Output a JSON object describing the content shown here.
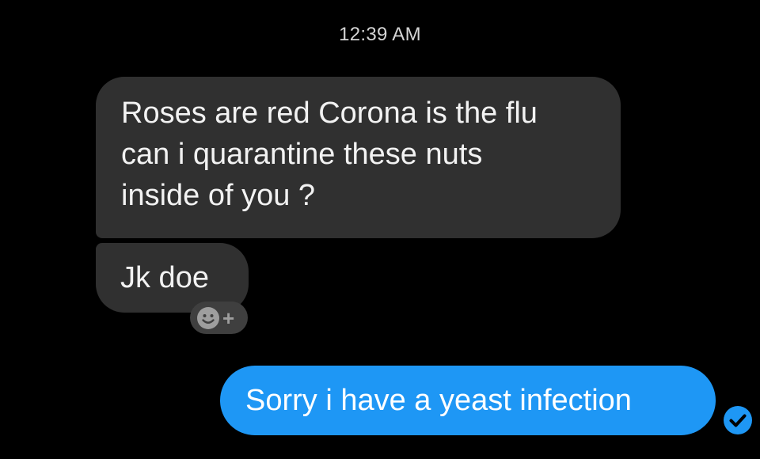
{
  "thread": {
    "timestamp": "12:39 AM",
    "incoming": [
      {
        "lines": [
          "Roses are red Corona is the flu",
          "can i quarantine these nuts",
          "inside of you ?"
        ]
      },
      {
        "lines": [
          "Jk doe"
        ]
      }
    ],
    "reaction_button": {
      "icon": "smiley-add-icon",
      "plus": "+"
    },
    "outgoing": [
      {
        "text": "Sorry i have a yeast infection",
        "status_icon": "read-receipt-check-icon"
      }
    ]
  },
  "colors": {
    "background": "#000000",
    "incoming_bubble": "#303030",
    "outgoing_bubble": "#1e97f5",
    "reaction_button": "#3f3f3f",
    "receipt": "#1e97f5"
  }
}
